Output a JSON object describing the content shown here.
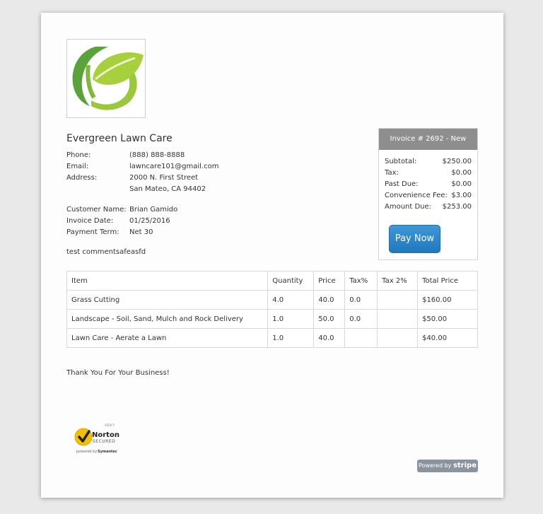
{
  "company": {
    "name": "Evergreen Lawn Care",
    "phone_label": "Phone:",
    "phone": "(888) 888-8888",
    "email_label": "Email:",
    "email": "lawncare101@gmail.com",
    "address_label": "Address:",
    "address_line1": "2000 N. First Street",
    "address_line2": "San Mateo, CA 94402"
  },
  "customer": {
    "name_label": "Customer Name:",
    "name": "Brian Gamido",
    "date_label": "Invoice Date:",
    "date": "01/25/2016",
    "term_label": "Payment Term:",
    "term": "Net 30"
  },
  "comments": "test commentsafeasfd",
  "summary": {
    "header": "Invoice # 2692 - New",
    "rows": [
      {
        "label": "Subtotal:",
        "value": "$250.00"
      },
      {
        "label": "Tax:",
        "value": "$0.00"
      },
      {
        "label": "Past Due:",
        "value": "$0.00"
      },
      {
        "label": "Convenience Fee:",
        "value": "$3.00"
      },
      {
        "label": "Amount Due:",
        "value": "$253.00"
      }
    ],
    "pay_label": "Pay Now",
    "pay_color": "#2a82c6"
  },
  "table": {
    "headers": [
      "Item",
      "Quantity",
      "Price",
      "Tax%",
      "Tax 2%",
      "Total Price"
    ],
    "rows": [
      [
        "Grass Cutting",
        "4.0",
        "40.0",
        "0.0",
        "",
        "$160.00"
      ],
      [
        "Landscape - Soil, Sand, Mulch and Rock Delivery",
        "1.0",
        "50.0",
        "0.0",
        "",
        "$50.00"
      ],
      [
        "Lawn Care - Aerate a Lawn",
        "1.0",
        "40.0",
        "",
        "",
        "$40.00"
      ]
    ]
  },
  "footer": {
    "thanks": "Thank You For Your Business!",
    "norton_top": "VERIFY",
    "norton_brand": "Norton",
    "norton_secured": "SECURED",
    "norton_powered": "powered by",
    "norton_symantec": "Symantec",
    "stripe_powered": "Powered by",
    "stripe_brand": "stripe"
  },
  "icons": {
    "logo": "leaf-logo-icon",
    "norton_check": "check-icon"
  }
}
